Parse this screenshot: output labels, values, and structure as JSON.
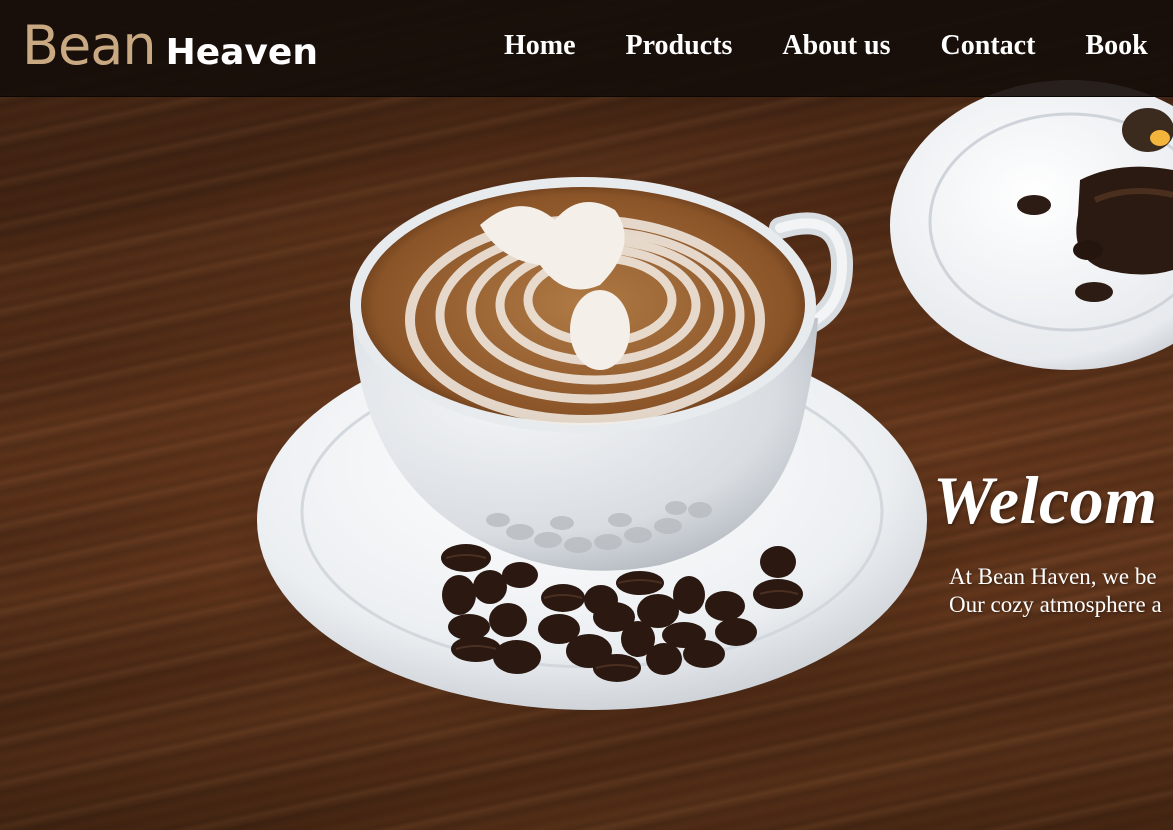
{
  "brand": {
    "primary": "Bean",
    "secondary": "Heaven"
  },
  "nav": {
    "links": [
      "Home",
      "Products",
      "About us",
      "Contact",
      "Book"
    ]
  },
  "hero": {
    "heading": "Welcom",
    "lines": [
      "At Bean Haven, we be",
      "Our cozy atmosphere a"
    ],
    "image": "latte-art-cup-with-coffee-beans-on-wooden-table"
  },
  "colors": {
    "brand_accent": "#c9a982",
    "nav_background": "#160e0a",
    "text": "#ffffff"
  }
}
